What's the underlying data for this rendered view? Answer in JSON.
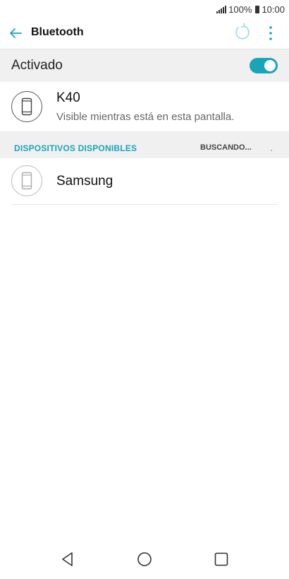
{
  "status_bar": {
    "battery_percent": "100%",
    "time": "10:00",
    "icons": [
      "signal-icon",
      "battery-icon"
    ]
  },
  "app_bar": {
    "title": "Bluetooth",
    "icons": [
      "back-arrow-icon",
      "refresh-icon",
      "more-vert-icon"
    ]
  },
  "toggle": {
    "label": "Activado",
    "state": true,
    "accent_color": "#18a5b8"
  },
  "this_device": {
    "name": "K40",
    "subtitle": "Visible mientras está en esta pantalla.",
    "icon": "phone-icon"
  },
  "available": {
    "title": "DISPOSITIVOS DISPONIBLES",
    "status": "BUSCANDO...",
    "devices": [
      {
        "name": "Samsung",
        "icon": "phone-icon"
      }
    ]
  },
  "nav_bar": {
    "icons": [
      "nav-back-icon",
      "nav-home-icon",
      "nav-recents-icon"
    ]
  }
}
